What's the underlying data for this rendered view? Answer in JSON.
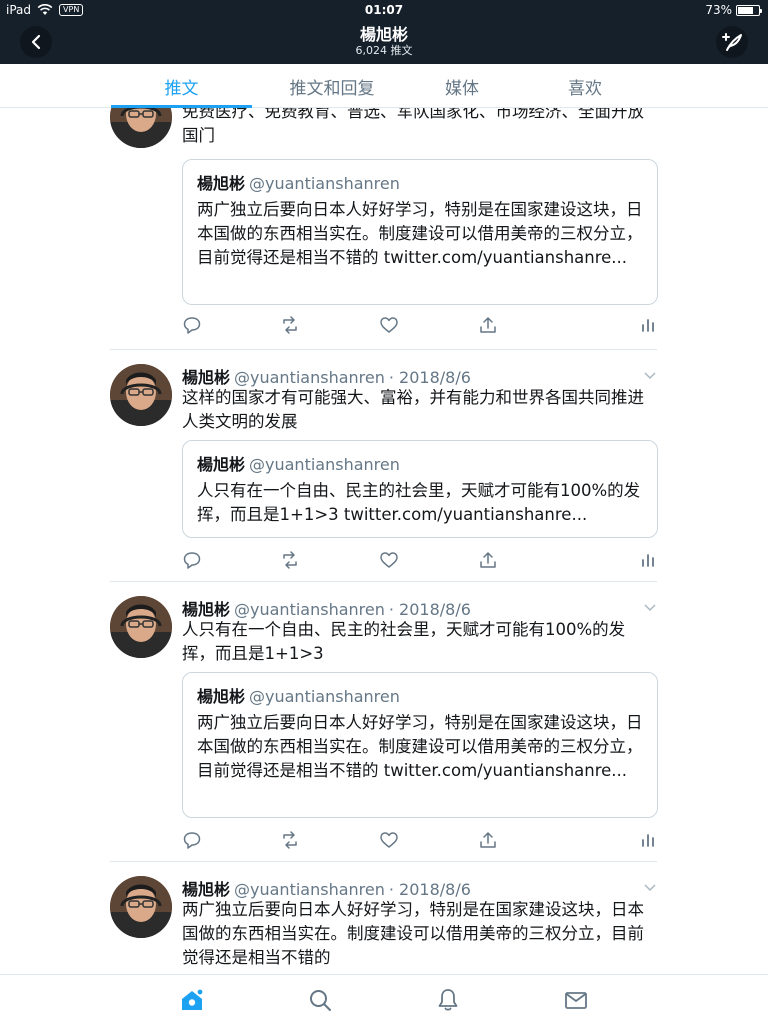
{
  "status_bar": {
    "device": "iPad",
    "vpn": "VPN",
    "time": "01:07",
    "battery_text": "73%",
    "battery_level": 0.73
  },
  "header": {
    "title": "楊旭彬",
    "tweet_count": "6,024 推文",
    "back_icon": "chevron-left-icon",
    "compose_icon": "compose-feather-icon"
  },
  "tabs": [
    {
      "label": "推文",
      "active": true
    },
    {
      "label": "推文和回复",
      "active": false
    },
    {
      "label": "媒体",
      "active": false
    },
    {
      "label": "喜欢",
      "active": false
    }
  ],
  "tweets": [
    {
      "text": "免费医疗、免费教育、普选、军队国家化、市场经济、全面开放国门",
      "quote": {
        "name": "楊旭彬",
        "handle": "@yuantianshanren",
        "text": "两广独立后要向日本人好好学习，特别是在国家建设这块，日本国做的东西相当实在。制度建设可以借用美帝的三权分立，目前觉得还是相当不错的 twitter.com/yuantianshanre..."
      }
    },
    {
      "name": "楊旭彬",
      "handle": "@yuantianshanren",
      "date": "· 2018/8/6",
      "text": "这样的国家才有可能强大、富裕，并有能力和世界各国共同推进人类文明的发展",
      "quote": {
        "name": "楊旭彬",
        "handle": "@yuantianshanren",
        "text": "人只有在一个自由、民主的社会里，天赋才可能有100%的发挥，而且是1+1>3 twitter.com/yuantianshanre..."
      }
    },
    {
      "name": "楊旭彬",
      "handle": "@yuantianshanren",
      "date": "· 2018/8/6",
      "text": "人只有在一个自由、民主的社会里，天赋才可能有100%的发挥，而且是1+1>3",
      "quote": {
        "name": "楊旭彬",
        "handle": "@yuantianshanren",
        "text": "两广独立后要向日本人好好学习，特别是在国家建设这块，日本国做的东西相当实在。制度建设可以借用美帝的三权分立，目前觉得还是相当不错的 twitter.com/yuantianshanre..."
      }
    },
    {
      "name": "楊旭彬",
      "handle": "@yuantianshanren",
      "date": "· 2018/8/6",
      "text": "两广独立后要向日本人好好学习，特别是在国家建设这块，日本国做的东西相当实在。制度建设可以借用美帝的三权分立，目前觉得还是相当不错的"
    }
  ],
  "bottom_nav": [
    {
      "icon": "home-icon",
      "active": true
    },
    {
      "icon": "search-icon",
      "active": false
    },
    {
      "icon": "notifications-bell-icon",
      "active": false
    },
    {
      "icon": "messages-envelope-icon",
      "active": false
    }
  ],
  "colors": {
    "accent": "#1da1f2",
    "header_bg": "#15202b",
    "muted": "#657786"
  }
}
